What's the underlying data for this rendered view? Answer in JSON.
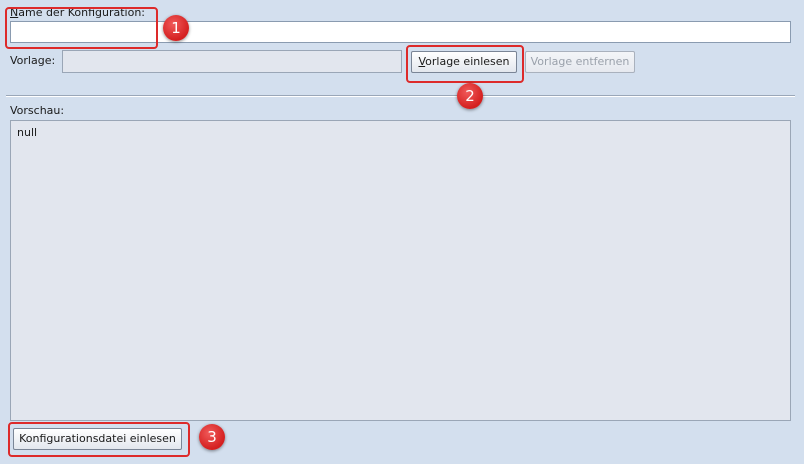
{
  "config_name": {
    "label": "Name der Konfiguration:",
    "label_mnemonic": "N",
    "label_rest": "ame der Konfiguration:",
    "value": ""
  },
  "template": {
    "label": "Vorlage:",
    "value": "",
    "load_button_mnemonic": "V",
    "load_button_rest": "orlage einlesen",
    "load_button": "Vorlage einlesen",
    "remove_button": "Vorlage entfernen"
  },
  "preview": {
    "label": "Vorschau:",
    "content": "null"
  },
  "footer": {
    "button_pre": "Konf",
    "button_mnemonic": "i",
    "button_post": "gurationsdatei einlesen",
    "button": "Konfigurationsdatei einlesen"
  },
  "markers": [
    "1",
    "2",
    "3"
  ],
  "colors": {
    "background": "#d3dfee",
    "marker": "#dd2a2a",
    "disabled_field": "#e2e6ee"
  }
}
